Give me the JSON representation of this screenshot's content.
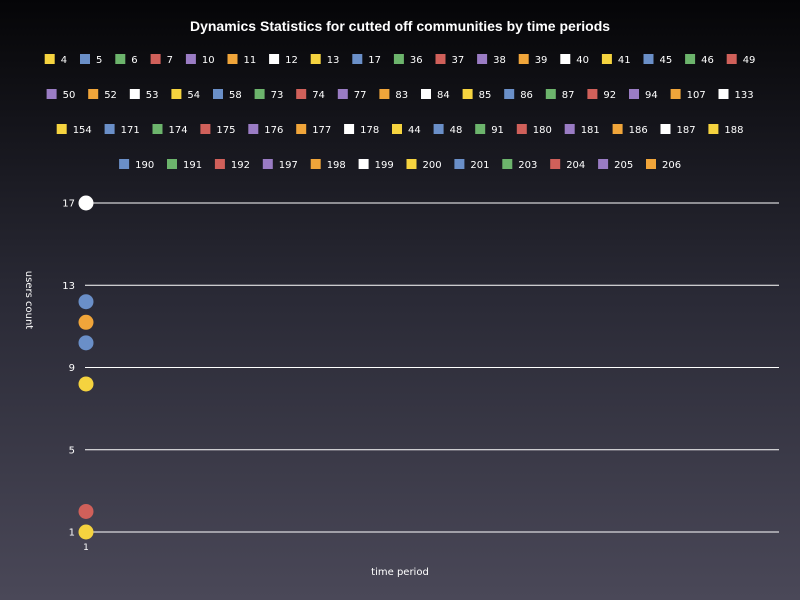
{
  "chart_data": {
    "type": "scatter",
    "title": "Dynamics Statistics for cutted off communities by time periods",
    "xlabel": "time period",
    "ylabel": "users count",
    "x_ticks": [
      1
    ],
    "y_ticks": [
      1,
      5,
      9,
      13,
      17
    ],
    "ylim": [
      1,
      17
    ],
    "grid": true,
    "legend_position": "top",
    "palette": [
      "#f5d33f",
      "#6a8fc8",
      "#6cb46c",
      "#d0605a",
      "#9a7cc4",
      "#f0a53a",
      "#ffffff"
    ],
    "series": [
      {
        "name": "4",
        "values": []
      },
      {
        "name": "5",
        "values": []
      },
      {
        "name": "6",
        "values": []
      },
      {
        "name": "7",
        "values": []
      },
      {
        "name": "10",
        "values": []
      },
      {
        "name": "11",
        "values": []
      },
      {
        "name": "12",
        "values": []
      },
      {
        "name": "13",
        "values": []
      },
      {
        "name": "17",
        "values": []
      },
      {
        "name": "36",
        "values": []
      },
      {
        "name": "37",
        "values": []
      },
      {
        "name": "38",
        "values": []
      },
      {
        "name": "39",
        "values": []
      },
      {
        "name": "40",
        "values": []
      },
      {
        "name": "41",
        "values": []
      },
      {
        "name": "45",
        "values": []
      },
      {
        "name": "46",
        "values": []
      },
      {
        "name": "49",
        "values": []
      },
      {
        "name": "50",
        "values": []
      },
      {
        "name": "52",
        "values": []
      },
      {
        "name": "53",
        "values": []
      },
      {
        "name": "54",
        "values": []
      },
      {
        "name": "58",
        "values": []
      },
      {
        "name": "73",
        "values": []
      },
      {
        "name": "74",
        "values": []
      },
      {
        "name": "77",
        "values": []
      },
      {
        "name": "83",
        "values": []
      },
      {
        "name": "84",
        "values": []
      },
      {
        "name": "85",
        "values": []
      },
      {
        "name": "86",
        "values": []
      },
      {
        "name": "87",
        "values": []
      },
      {
        "name": "92",
        "values": []
      },
      {
        "name": "94",
        "values": []
      },
      {
        "name": "107",
        "values": []
      },
      {
        "name": "133",
        "values": []
      },
      {
        "name": "154",
        "values": []
      },
      {
        "name": "171",
        "values": []
      },
      {
        "name": "174",
        "values": []
      },
      {
        "name": "175",
        "values": []
      },
      {
        "name": "176",
        "values": []
      },
      {
        "name": "177",
        "values": []
      },
      {
        "name": "178",
        "values": []
      },
      {
        "name": "44",
        "values": []
      },
      {
        "name": "48",
        "values": []
      },
      {
        "name": "91",
        "values": []
      },
      {
        "name": "180",
        "values": []
      },
      {
        "name": "181",
        "values": []
      },
      {
        "name": "186",
        "values": []
      },
      {
        "name": "187",
        "values": []
      },
      {
        "name": "188",
        "values": []
      },
      {
        "name": "190",
        "values": []
      },
      {
        "name": "191",
        "values": []
      },
      {
        "name": "192",
        "values": []
      },
      {
        "name": "197",
        "values": []
      },
      {
        "name": "198",
        "values": []
      },
      {
        "name": "199",
        "values": []
      },
      {
        "name": "200",
        "values": []
      },
      {
        "name": "201",
        "values": []
      },
      {
        "name": "203",
        "values": []
      },
      {
        "name": "204",
        "values": []
      },
      {
        "name": "205",
        "values": []
      },
      {
        "name": "206",
        "values": []
      }
    ],
    "points": [
      {
        "x": 1,
        "y": 17,
        "color": "#ffffff"
      },
      {
        "x": 1,
        "y": 12.2,
        "color": "#6a8fc8"
      },
      {
        "x": 1,
        "y": 11.2,
        "color": "#f0a53a"
      },
      {
        "x": 1,
        "y": 10.2,
        "color": "#6a8fc8"
      },
      {
        "x": 1,
        "y": 8.2,
        "color": "#f5d33f"
      },
      {
        "x": 1,
        "y": 2,
        "color": "#d0605a"
      },
      {
        "x": 1,
        "y": 1,
        "color": "#f5d33f"
      }
    ]
  }
}
